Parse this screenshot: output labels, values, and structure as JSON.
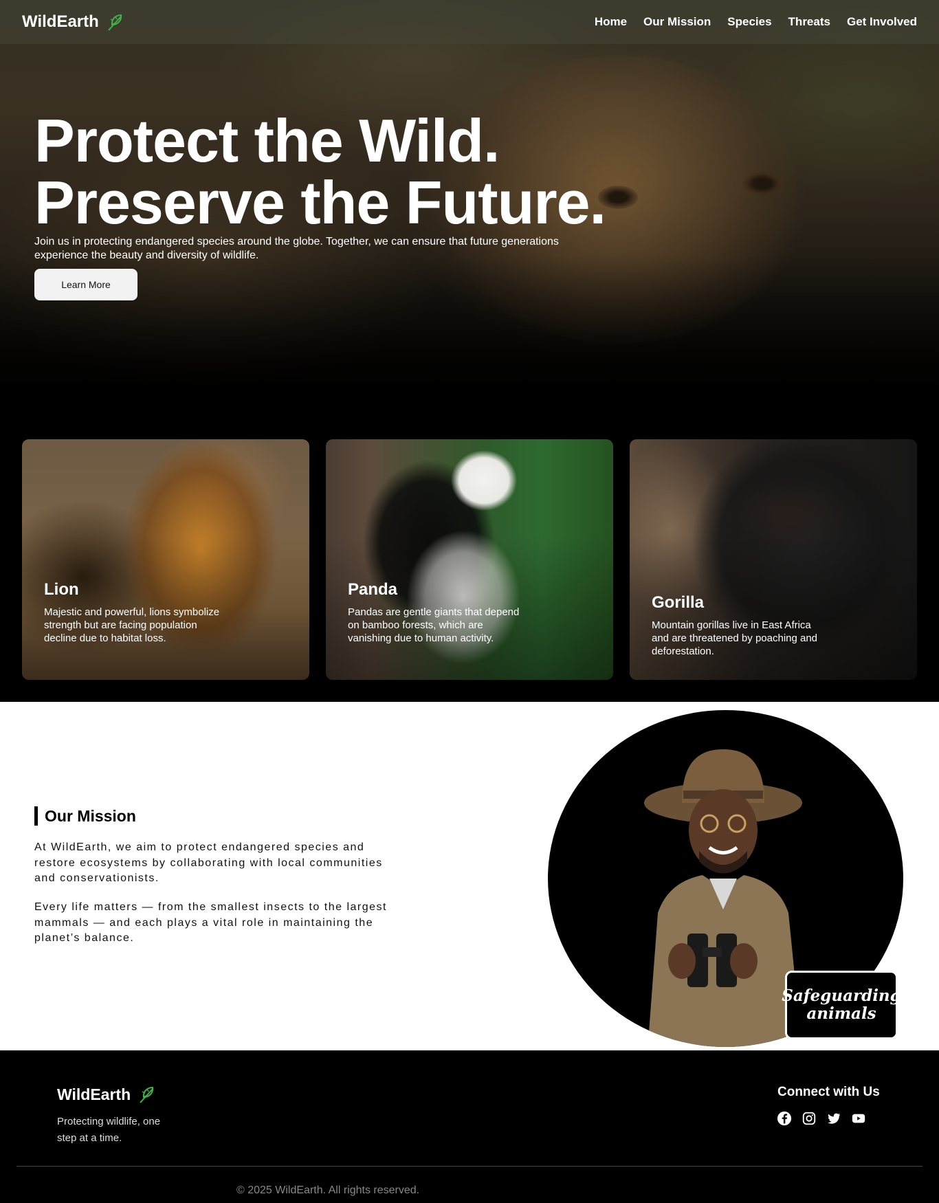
{
  "brand": {
    "name": "WildEarth",
    "leaf_icon": "leaf-icon",
    "accent": "#3fb34a"
  },
  "nav": {
    "items": [
      {
        "label": "Home"
      },
      {
        "label": "Our Mission"
      },
      {
        "label": "Species"
      },
      {
        "label": "Threats"
      },
      {
        "label": "Get Involved"
      }
    ]
  },
  "hero": {
    "title_line1": "Protect the Wild.",
    "title_line2": "Preserve the Future.",
    "subtitle": "Join us in protecting endangered species around the globe. Together, we can ensure that future generations experience the beauty and diversity of wildlife.",
    "button_label": "Learn More"
  },
  "species": [
    {
      "name": "Lion",
      "description": "Majestic and powerful, lions symbolize strength but are facing population decline due to habitat loss."
    },
    {
      "name": "Panda",
      "description": "Pandas are gentle giants that depend on bamboo forests, which are vanishing due to human activity."
    },
    {
      "name": "Gorilla",
      "description": "Mountain gorillas live in East Africa and are threatened by poaching and deforestation."
    }
  ],
  "mission": {
    "heading": "Our Mission",
    "paragraph1": "At WildEarth, we aim to protect endangered species and restore ecosystems by collaborating with local communities and conservationists.",
    "paragraph2": "Every life matters — from the smallest insects to the largest mammals — and each plays a vital role in maintaining the planet’s balance.",
    "badge": "Safeguarding animals"
  },
  "footer": {
    "brand": "WildEarth",
    "tagline": "Protecting wildlife, one step at a time.",
    "connect_heading": "Connect with Us",
    "socials": [
      "facebook-icon",
      "instagram-icon",
      "twitter-icon",
      "youtube-icon"
    ],
    "copyright": "© 2025 WildEarth. All rights reserved."
  }
}
